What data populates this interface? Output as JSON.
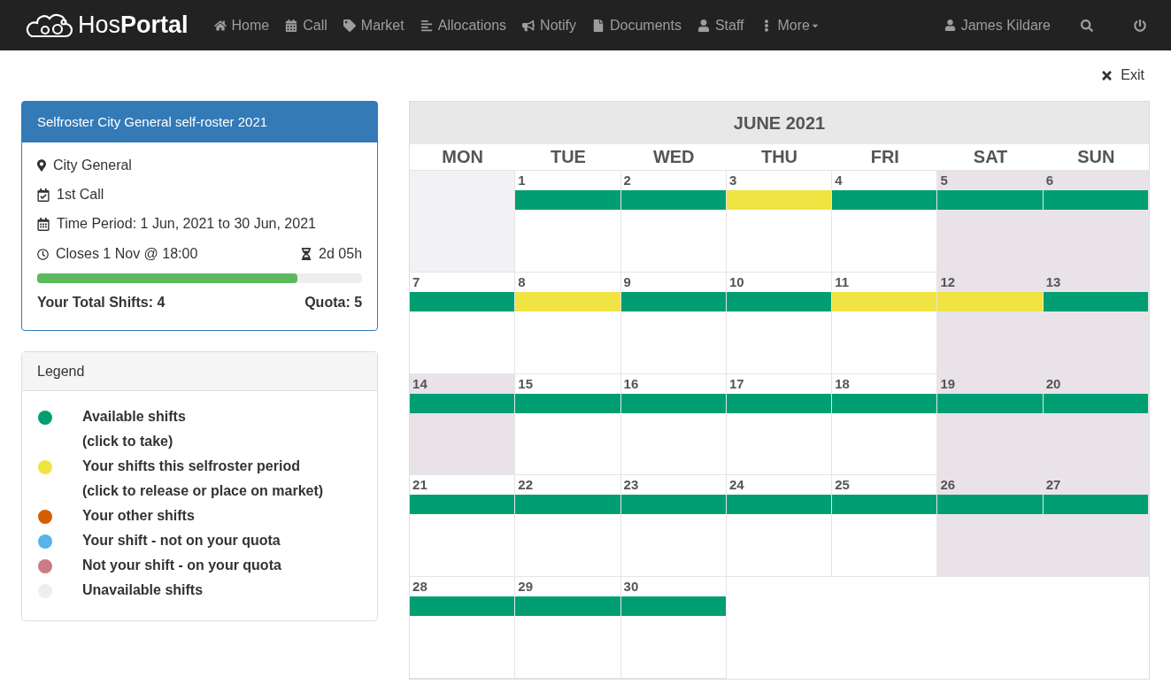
{
  "nav": {
    "logo": "Hos**Portal**",
    "items": [
      {
        "label": "Home"
      },
      {
        "label": "Call"
      },
      {
        "label": "Market"
      },
      {
        "label": "Allocations"
      },
      {
        "label": "Notify"
      },
      {
        "label": "Documents"
      },
      {
        "label": "Staff"
      },
      {
        "label": "More"
      }
    ],
    "user": "James Kildare"
  },
  "exit": "Exit",
  "roster": {
    "title": "Selfroster City General self-roster 2021",
    "location": "City General",
    "call": "1st Call",
    "period": "Time Period: 1 Jun, 2021 to 30 Jun, 2021",
    "closes": "Closes 1 Nov @ 18:00",
    "remaining": "2d 05h",
    "level": 0.8,
    "total": "Your Total Shifts: 4",
    "quota": "Quota: 5"
  },
  "legend": {
    "title": "Legend",
    "items": [
      {
        "color": "#009e73",
        "label": "Available shifts",
        "note": "(click to take)"
      },
      {
        "color": "#f0e442",
        "label": "Your shifts this selfroster period",
        "note": "(click to release or place on market)"
      },
      {
        "color": "#d55e00",
        "label": "Your other shifts"
      },
      {
        "color": "#56b4e9",
        "label": "Your shift - not on your quota"
      },
      {
        "color": "#cc7a86",
        "label": "Not your shift - on your quota"
      },
      {
        "color": "#eeeeee",
        "label": "Unavailable shifts"
      }
    ]
  },
  "calendar": {
    "title": "JUNE 2021",
    "weekdays": [
      "MON",
      "TUE",
      "WED",
      "THU",
      "FRI",
      "SAT",
      "SUN"
    ],
    "days": [
      {
        "day": "1",
        "shaded": false,
        "color": "#009e73"
      },
      {
        "day": "2",
        "shaded": false,
        "color": "#009e73"
      },
      {
        "day": "3",
        "shaded": false,
        "color": "#f0e442"
      },
      {
        "day": "4",
        "shaded": false,
        "color": "#009e73"
      },
      {
        "day": "5",
        "shaded": true,
        "color": "#009e73"
      },
      {
        "day": "6",
        "shaded": true,
        "color": "#009e73"
      },
      {
        "day": "7",
        "shaded": false,
        "color": "#009e73"
      },
      {
        "day": "8",
        "shaded": false,
        "color": "#f0e442"
      },
      {
        "day": "9",
        "shaded": false,
        "color": "#009e73"
      },
      {
        "day": "10",
        "shaded": false,
        "color": "#009e73"
      },
      {
        "day": "11",
        "shaded": false,
        "color": "#f0e442"
      },
      {
        "day": "12",
        "shaded": true,
        "color": "#f0e442"
      },
      {
        "day": "13",
        "shaded": true,
        "color": "#009e73"
      },
      {
        "day": "14",
        "shaded": true,
        "color": "#009e73"
      },
      {
        "day": "15",
        "shaded": false,
        "color": "#009e73"
      },
      {
        "day": "16",
        "shaded": false,
        "color": "#009e73"
      },
      {
        "day": "17",
        "shaded": false,
        "color": "#009e73"
      },
      {
        "day": "18",
        "shaded": false,
        "color": "#009e73"
      },
      {
        "day": "19",
        "shaded": true,
        "color": "#009e73"
      },
      {
        "day": "20",
        "shaded": true,
        "color": "#009e73"
      },
      {
        "day": "21",
        "shaded": false,
        "color": "#009e73"
      },
      {
        "day": "22",
        "shaded": false,
        "color": "#009e73"
      },
      {
        "day": "23",
        "shaded": false,
        "color": "#009e73"
      },
      {
        "day": "24",
        "shaded": false,
        "color": "#009e73"
      },
      {
        "day": "25",
        "shaded": false,
        "color": "#009e73"
      },
      {
        "day": "26",
        "shaded": true,
        "color": "#009e73"
      },
      {
        "day": "27",
        "shaded": true,
        "color": "#009e73"
      },
      {
        "day": "28",
        "shaded": false,
        "color": "#009e73"
      },
      {
        "day": "29",
        "shaded": false,
        "color": "#009e73"
      },
      {
        "day": "30",
        "shaded": false,
        "color": "#009e73"
      }
    ]
  }
}
